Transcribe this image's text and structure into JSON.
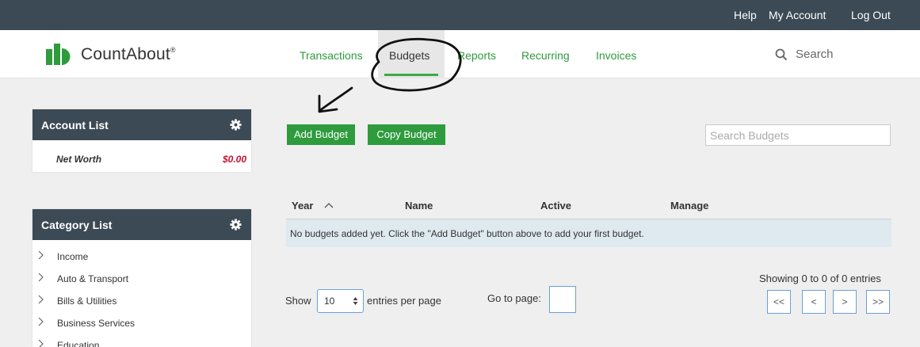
{
  "topbar": {
    "help": "Help",
    "my_account": "My Account",
    "logout": "Log Out"
  },
  "brand": {
    "name": "CountAbout",
    "reg": "®",
    "logo_color": "#2e9b3d"
  },
  "nav": {
    "tabs": [
      {
        "label": "Transactions"
      },
      {
        "label": "Budgets"
      },
      {
        "label": "Reports"
      },
      {
        "label": "Recurring"
      },
      {
        "label": "Invoices"
      }
    ],
    "active_tab": "Budgets",
    "search_label": "Search"
  },
  "account_list": {
    "title": "Account List",
    "net_worth_label": "Net Worth",
    "net_worth_value": "$0.00"
  },
  "category_list": {
    "title": "Category List",
    "items": [
      {
        "label": "Income"
      },
      {
        "label": "Auto & Transport"
      },
      {
        "label": "Bills & Utilities"
      },
      {
        "label": "Business Services"
      },
      {
        "label": "Education"
      }
    ]
  },
  "toolbar": {
    "add_budget": "Add Budget",
    "copy_budget": "Copy Budget",
    "search_placeholder": "Search Budgets"
  },
  "table": {
    "columns": [
      "Year",
      "Name",
      "Active",
      "Manage"
    ],
    "sort_indicator": "^",
    "empty_message": "No budgets added yet. Click the \"Add Budget\" button above to add your first budget."
  },
  "pagination": {
    "show_label": "Show",
    "per_page_value": "10",
    "entries_label": "entries per page",
    "goto_label": "Go to page:",
    "showing": "Showing 0 to 0 of 0 entries",
    "buttons": [
      "<<",
      "<",
      ">",
      ">>"
    ]
  },
  "colors": {
    "header_bg": "#3c4a55",
    "accent_green": "#2e9b3d",
    "net_worth_red": "#c8102e",
    "empty_row_bg": "#dfe9f0"
  }
}
